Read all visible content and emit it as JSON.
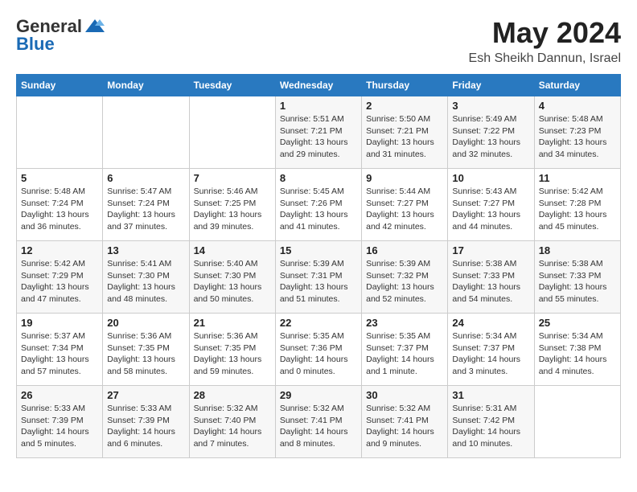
{
  "header": {
    "logo_general": "General",
    "logo_blue": "Blue",
    "month_year": "May 2024",
    "location": "Esh Sheikh Dannun, Israel"
  },
  "weekdays": [
    "Sunday",
    "Monday",
    "Tuesday",
    "Wednesday",
    "Thursday",
    "Friday",
    "Saturday"
  ],
  "weeks": [
    [
      {
        "day": "",
        "info": ""
      },
      {
        "day": "",
        "info": ""
      },
      {
        "day": "",
        "info": ""
      },
      {
        "day": "1",
        "info": "Sunrise: 5:51 AM\nSunset: 7:21 PM\nDaylight: 13 hours\nand 29 minutes."
      },
      {
        "day": "2",
        "info": "Sunrise: 5:50 AM\nSunset: 7:21 PM\nDaylight: 13 hours\nand 31 minutes."
      },
      {
        "day": "3",
        "info": "Sunrise: 5:49 AM\nSunset: 7:22 PM\nDaylight: 13 hours\nand 32 minutes."
      },
      {
        "day": "4",
        "info": "Sunrise: 5:48 AM\nSunset: 7:23 PM\nDaylight: 13 hours\nand 34 minutes."
      }
    ],
    [
      {
        "day": "5",
        "info": "Sunrise: 5:48 AM\nSunset: 7:24 PM\nDaylight: 13 hours\nand 36 minutes."
      },
      {
        "day": "6",
        "info": "Sunrise: 5:47 AM\nSunset: 7:24 PM\nDaylight: 13 hours\nand 37 minutes."
      },
      {
        "day": "7",
        "info": "Sunrise: 5:46 AM\nSunset: 7:25 PM\nDaylight: 13 hours\nand 39 minutes."
      },
      {
        "day": "8",
        "info": "Sunrise: 5:45 AM\nSunset: 7:26 PM\nDaylight: 13 hours\nand 41 minutes."
      },
      {
        "day": "9",
        "info": "Sunrise: 5:44 AM\nSunset: 7:27 PM\nDaylight: 13 hours\nand 42 minutes."
      },
      {
        "day": "10",
        "info": "Sunrise: 5:43 AM\nSunset: 7:27 PM\nDaylight: 13 hours\nand 44 minutes."
      },
      {
        "day": "11",
        "info": "Sunrise: 5:42 AM\nSunset: 7:28 PM\nDaylight: 13 hours\nand 45 minutes."
      }
    ],
    [
      {
        "day": "12",
        "info": "Sunrise: 5:42 AM\nSunset: 7:29 PM\nDaylight: 13 hours\nand 47 minutes."
      },
      {
        "day": "13",
        "info": "Sunrise: 5:41 AM\nSunset: 7:30 PM\nDaylight: 13 hours\nand 48 minutes."
      },
      {
        "day": "14",
        "info": "Sunrise: 5:40 AM\nSunset: 7:30 PM\nDaylight: 13 hours\nand 50 minutes."
      },
      {
        "day": "15",
        "info": "Sunrise: 5:39 AM\nSunset: 7:31 PM\nDaylight: 13 hours\nand 51 minutes."
      },
      {
        "day": "16",
        "info": "Sunrise: 5:39 AM\nSunset: 7:32 PM\nDaylight: 13 hours\nand 52 minutes."
      },
      {
        "day": "17",
        "info": "Sunrise: 5:38 AM\nSunset: 7:33 PM\nDaylight: 13 hours\nand 54 minutes."
      },
      {
        "day": "18",
        "info": "Sunrise: 5:38 AM\nSunset: 7:33 PM\nDaylight: 13 hours\nand 55 minutes."
      }
    ],
    [
      {
        "day": "19",
        "info": "Sunrise: 5:37 AM\nSunset: 7:34 PM\nDaylight: 13 hours\nand 57 minutes."
      },
      {
        "day": "20",
        "info": "Sunrise: 5:36 AM\nSunset: 7:35 PM\nDaylight: 13 hours\nand 58 minutes."
      },
      {
        "day": "21",
        "info": "Sunrise: 5:36 AM\nSunset: 7:35 PM\nDaylight: 13 hours\nand 59 minutes."
      },
      {
        "day": "22",
        "info": "Sunrise: 5:35 AM\nSunset: 7:36 PM\nDaylight: 14 hours\nand 0 minutes."
      },
      {
        "day": "23",
        "info": "Sunrise: 5:35 AM\nSunset: 7:37 PM\nDaylight: 14 hours\nand 1 minute."
      },
      {
        "day": "24",
        "info": "Sunrise: 5:34 AM\nSunset: 7:37 PM\nDaylight: 14 hours\nand 3 minutes."
      },
      {
        "day": "25",
        "info": "Sunrise: 5:34 AM\nSunset: 7:38 PM\nDaylight: 14 hours\nand 4 minutes."
      }
    ],
    [
      {
        "day": "26",
        "info": "Sunrise: 5:33 AM\nSunset: 7:39 PM\nDaylight: 14 hours\nand 5 minutes."
      },
      {
        "day": "27",
        "info": "Sunrise: 5:33 AM\nSunset: 7:39 PM\nDaylight: 14 hours\nand 6 minutes."
      },
      {
        "day": "28",
        "info": "Sunrise: 5:32 AM\nSunset: 7:40 PM\nDaylight: 14 hours\nand 7 minutes."
      },
      {
        "day": "29",
        "info": "Sunrise: 5:32 AM\nSunset: 7:41 PM\nDaylight: 14 hours\nand 8 minutes."
      },
      {
        "day": "30",
        "info": "Sunrise: 5:32 AM\nSunset: 7:41 PM\nDaylight: 14 hours\nand 9 minutes."
      },
      {
        "day": "31",
        "info": "Sunrise: 5:31 AM\nSunset: 7:42 PM\nDaylight: 14 hours\nand 10 minutes."
      },
      {
        "day": "",
        "info": ""
      }
    ]
  ]
}
